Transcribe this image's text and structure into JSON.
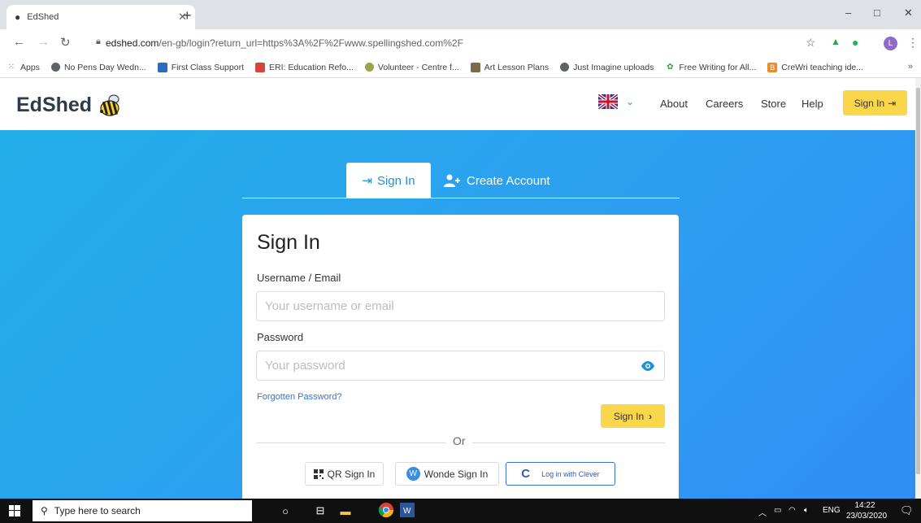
{
  "browser": {
    "tab_title": "EdShed",
    "new_tab": "+",
    "url_host": "edshed.com",
    "url_path": "/en-gb/login?return_url=https%3A%2F%2Fwww.spellingshed.com%2F",
    "profile_initial": "L",
    "window_minimize": "–",
    "window_restore": "□",
    "window_close": "✕"
  },
  "bookmarks": {
    "apps_label": "Apps",
    "items": [
      "No Pens Day Wedn...",
      "First Class Support",
      "ERI: Education Refo...",
      "Volunteer - Centre f...",
      "Art Lesson Plans",
      "Just Imagine uploads",
      "Free Writing for All...",
      "CreWri teaching ide..."
    ],
    "more": "»"
  },
  "site": {
    "logo_text": "EdShed",
    "nav": [
      "About",
      "Careers",
      "Store",
      "Help"
    ],
    "signin_button": "Sign In"
  },
  "auth": {
    "tab_signin": "Sign In",
    "tab_create": "Create Account",
    "card_title": "Sign In",
    "username_label": "Username / Email",
    "username_placeholder": "Your username or email",
    "password_label": "Password",
    "password_placeholder": "Your password",
    "forgot_link": "Forgotten Password?",
    "submit_label": "Sign In",
    "or_text": "Or",
    "qr_button": "QR Sign In",
    "wonde_button": "Wonde Sign In",
    "clever_button": "Log in with Clever"
  },
  "taskbar": {
    "search_placeholder": "Type here to search",
    "language": "ENG",
    "time": "14:22",
    "date": "23/03/2020"
  },
  "colors": {
    "hero_blue": "#2e9ff0",
    "accent_yellow": "#fad64b",
    "link_blue": "#3273dc"
  }
}
